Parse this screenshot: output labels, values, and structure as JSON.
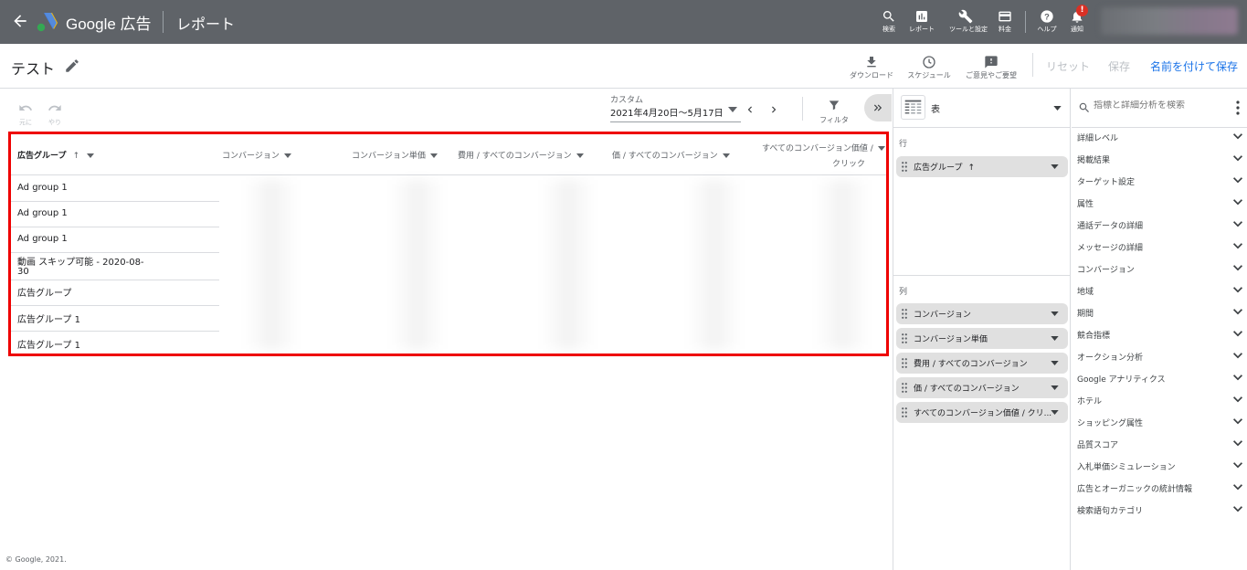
{
  "app": {
    "product_name": "Google 広告",
    "section_title": "レポート",
    "top_icons": [
      {
        "icon": "search-icon",
        "label": "検索"
      },
      {
        "icon": "reports-icon",
        "label": "レポート"
      },
      {
        "icon": "wrench-icon",
        "label": "ツールと設定"
      },
      {
        "icon": "billing-icon",
        "label": "料金"
      },
      {
        "icon": "help-icon",
        "label": "ヘルプ"
      },
      {
        "icon": "bell-icon",
        "label": "通知"
      }
    ],
    "notification_badge": "!"
  },
  "report": {
    "name": "テスト",
    "actions": [
      {
        "icon": "download-icon",
        "label": "ダウンロード"
      },
      {
        "icon": "clock-icon",
        "label": "スケジュール"
      },
      {
        "icon": "feedback-icon",
        "label": "ご意見やご要望"
      }
    ],
    "reset_label": "リセット",
    "save_label": "保存",
    "save_as_label": "名前を付けて保存"
  },
  "toolbar": {
    "undo_label": "元に",
    "redo_label": "やり",
    "date_label": "カスタム",
    "date_range": "2021年4月20日～5月17日",
    "filter_label": "フィルタ"
  },
  "table": {
    "columns": [
      "広告グループ",
      "コンバージョン",
      "コンバージョン単価",
      "費用 / すべてのコンバージョン",
      "価 / すべてのコンバージョン",
      "すべてのコンバージョン価値 /",
      "クリック"
    ],
    "rows": [
      "Ad group 1",
      "Ad group 1",
      "Ad group 1",
      "動画 スキップ可能 - 2020-08-",
      "30",
      "広告グループ",
      "広告グループ 1",
      "広告グループ 1"
    ]
  },
  "viz": {
    "type_label": "表",
    "rows_label": "行",
    "row_chips": [
      "広告グループ"
    ],
    "columns_label": "列",
    "column_chips": [
      "コンバージョン",
      "コンバージョン単価",
      "費用 / すべてのコンバージョン",
      "価 / すべてのコンバージョン",
      "すべてのコンバージョン価値 / クリ..."
    ]
  },
  "dimensions": {
    "search_placeholder": "指標と詳細分析を検索",
    "categories": [
      "詳細レベル",
      "掲載結果",
      "ターゲット設定",
      "属性",
      "通話データの詳細",
      "メッセージの詳細",
      "コンバージョン",
      "地域",
      "期間",
      "競合指標",
      "オークション分析",
      "Google アナリティクス",
      "ホテル",
      "ショッピング属性",
      "品質スコア",
      "入札単価シミュレーション",
      "広告とオーガニックの統計情報",
      "検索語句カテゴリ"
    ]
  },
  "footer": "© Google, 2021."
}
